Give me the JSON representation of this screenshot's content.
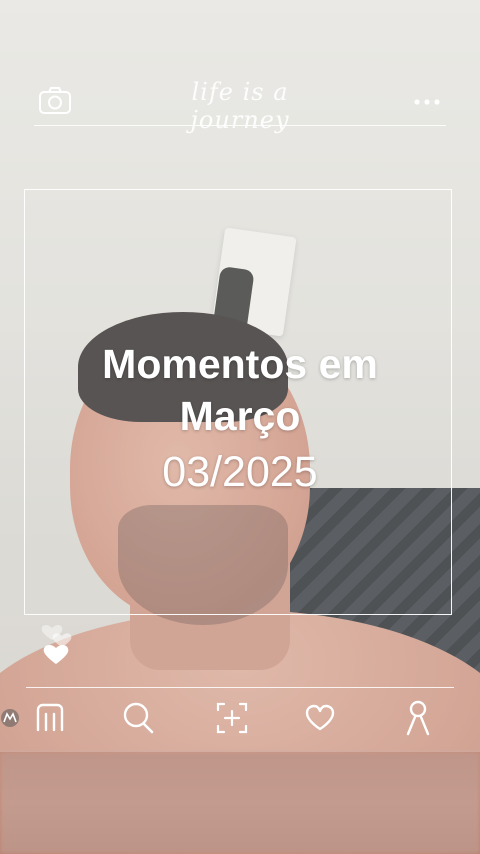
{
  "header": {
    "tagline": "life is a journey",
    "camera_icon": "camera-icon",
    "more_icon": "more-dots-icon"
  },
  "card": {
    "title_line1": "Momentos em",
    "title_line2": "Março",
    "date": "03/2025"
  },
  "likes": {
    "icon": "hearts-icon"
  },
  "nav": {
    "items": [
      {
        "name": "home",
        "icon": "home-icon"
      },
      {
        "name": "search",
        "icon": "search-icon"
      },
      {
        "name": "add",
        "icon": "add-frame-icon"
      },
      {
        "name": "likes",
        "icon": "heart-icon"
      },
      {
        "name": "profile",
        "icon": "profile-icon"
      }
    ],
    "brand_icon": "motorola-logo-icon"
  },
  "colors": {
    "overlay_text": "#ffffff",
    "skin": "#c98f7b",
    "wall": "#dcdbd5"
  }
}
